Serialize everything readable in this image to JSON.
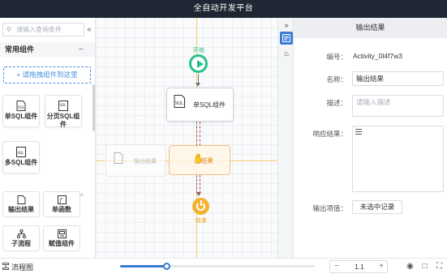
{
  "app": {
    "title": "全自动开发平台"
  },
  "left": {
    "search_placeholder": "请输入查询条件",
    "common_section": "常用组件",
    "common_toggle": "−",
    "dropzone_text": "+ 请拖拽组件到这里",
    "common_items": [
      {
        "label": "单SQL组件",
        "icon": "sql-file-icon"
      },
      {
        "label": "分页SQL组件",
        "icon": "sql-page-icon"
      },
      {
        "label": "多SQL组件",
        "icon": "sql-multi-icon"
      }
    ],
    "tools_section": "工具",
    "tools_toggle": "^",
    "tool_items": [
      {
        "label": "输出结果",
        "icon": "output-file-icon"
      },
      {
        "label": "单函数",
        "icon": "function-icon"
      },
      {
        "label": "子流程",
        "icon": "subflow-icon"
      },
      {
        "label": "赋值组件",
        "icon": "assign-icon"
      }
    ]
  },
  "canvas": {
    "start_label": "开始",
    "task_label": "单SQL组件",
    "ghost_label": "输出结果",
    "output_label": "出结果",
    "end_label": "结束"
  },
  "right": {
    "header": "输出结果",
    "id_label": "编号：",
    "id_value": "Activity_0l4f7w3",
    "name_label": "名称：",
    "name_value": "输出结果",
    "desc_label": "描述：",
    "desc_placeholder": "请输入描述",
    "response_label": "响应结果：",
    "output_label": "输出项值：",
    "output_button": "未选中记录"
  },
  "bottom": {
    "label": "流程图",
    "zoom_value": "1.1",
    "zoom_minus": "−",
    "zoom_plus": "+"
  },
  "colors": {
    "accent": "#3a7bd5",
    "start": "#27c28a",
    "end": "#f5b131",
    "guide": "#f2c96e"
  }
}
